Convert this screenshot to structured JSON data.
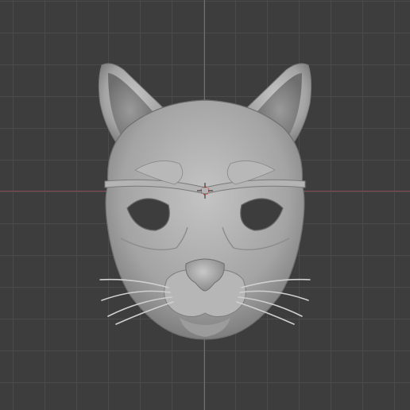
{
  "viewport": {
    "background_color": "#3d3d3d",
    "grid_color": "#4a4a4a",
    "x_axis_color": "#8a4a52",
    "y_axis_color": "#6a8a3a"
  },
  "scene": {
    "object_icon": "cat-mask-model",
    "cursor_icon": "3d-cursor-icon",
    "mesh_color": "#a8a8a8"
  }
}
